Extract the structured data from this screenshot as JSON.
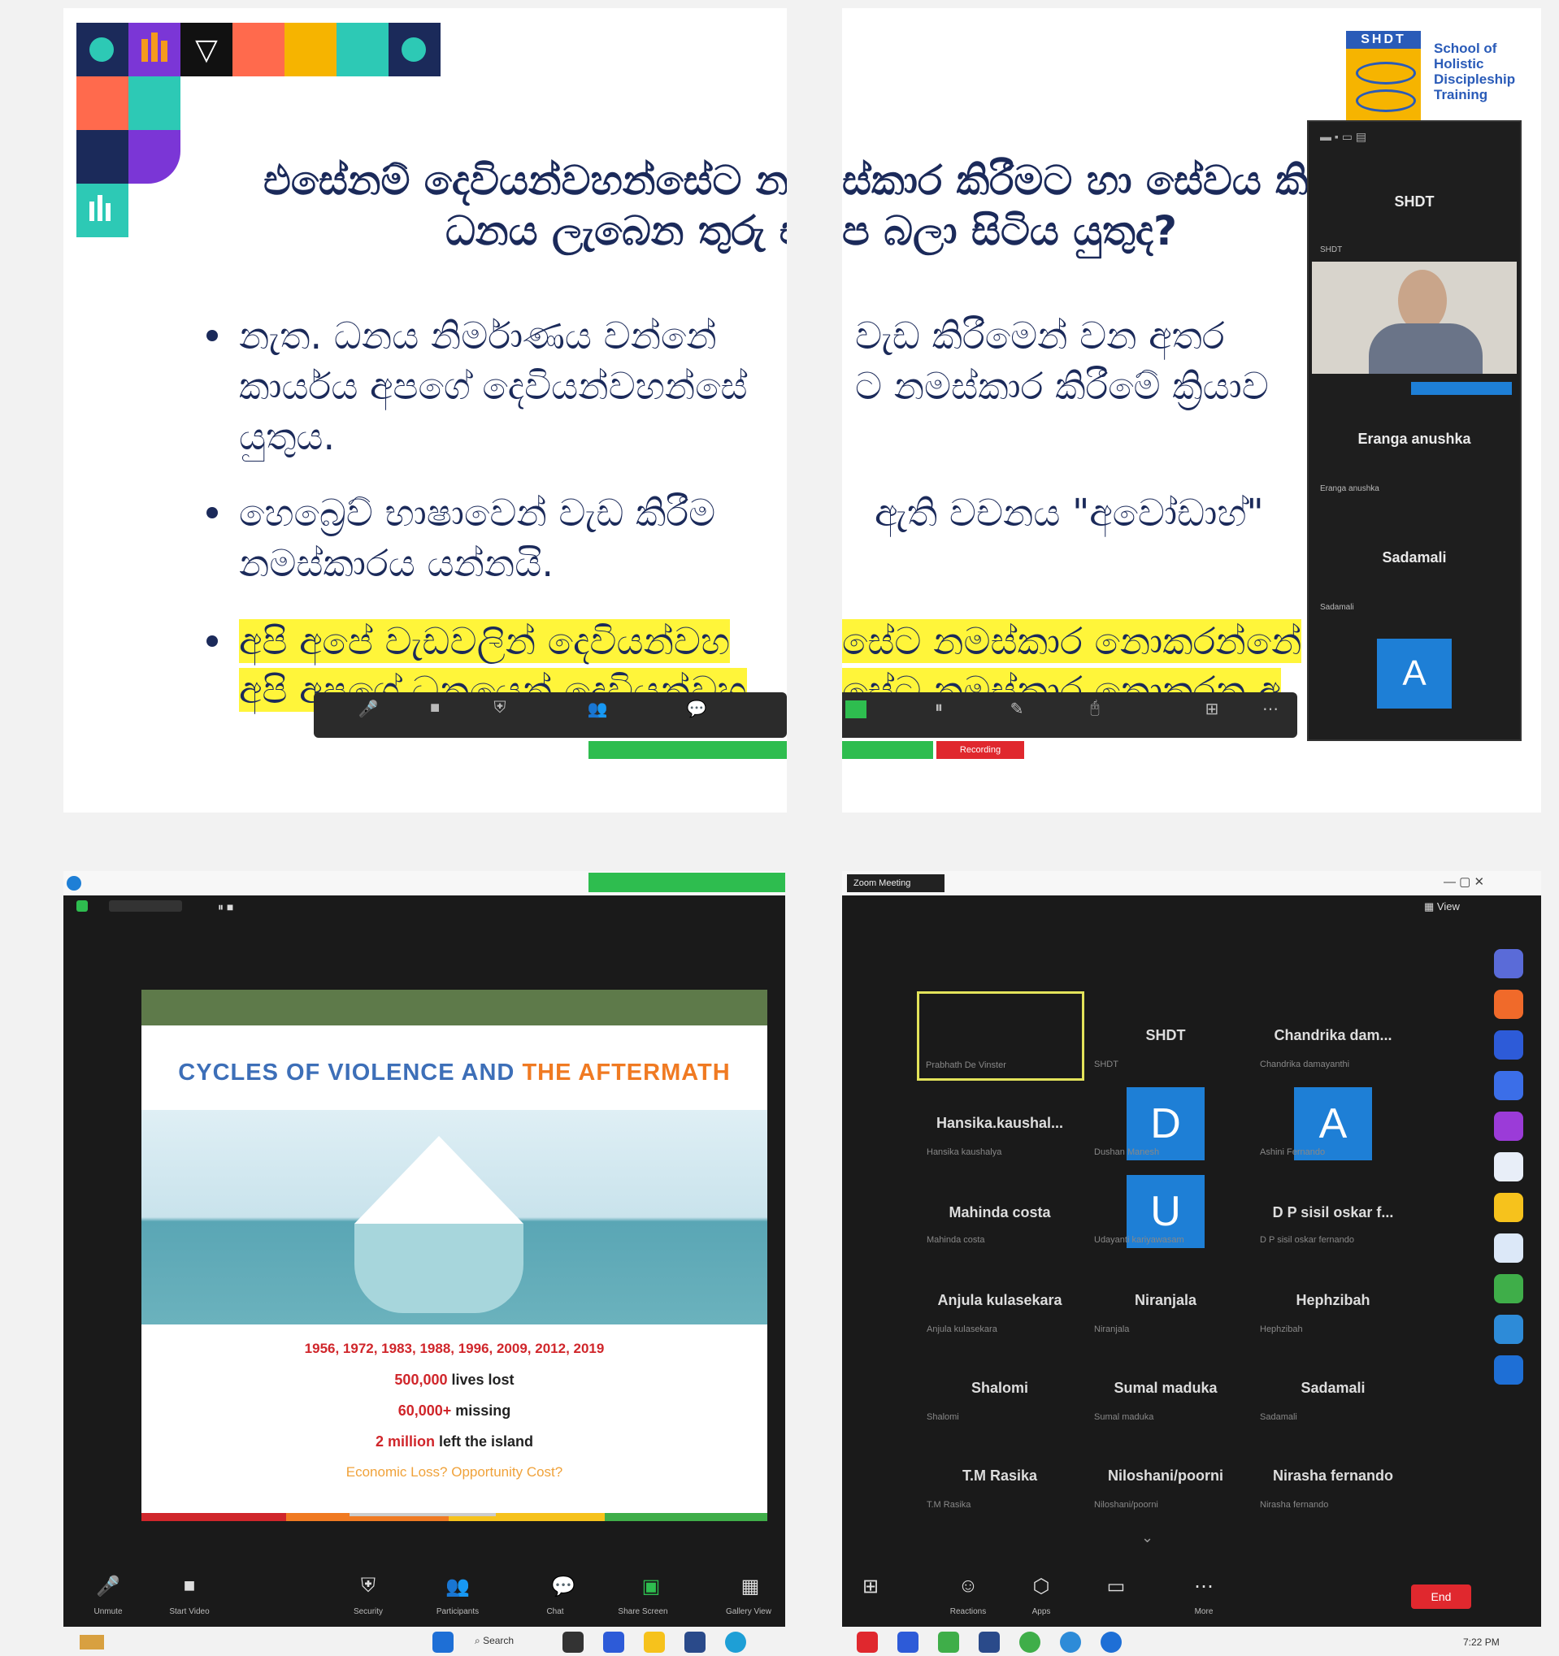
{
  "slide": {
    "title_line1_left": "එසේනම් දෙවියන්වහන්සේට නම",
    "title_line1_right": "ස්කාර කිරීමට හා සේවය කිරී",
    "title_line2_left": "ධනය ලැබෙන තුරු ඒ",
    "title_line2_right": "ප බලා සිටිය යුතුද?",
    "bullet1_l1_left": "නැත. ධනය නිර්මාණය වන්නේ",
    "bullet1_l1_right": "වැඩ කිරීමෙන් වන අතර",
    "bullet1_l2_left": "කාර්යය අපගේ දෙවියන්වහන්සේ",
    "bullet1_l2_right": "ට නමස්කාර කිරීමේ ක්‍රියාව",
    "bullet1_l3": "යුතුය.",
    "bullet2_l1_left": "හෙබ්‍රෙව් භාෂාවෙන් වැඩ කිරීම",
    "bullet2_l1_right": "ඇති වචනය \"අවෝඩාහ්\"",
    "bullet2_l2": "නමස්කාරය යන්නයි.",
    "bullet3_l1_left": "අපි අපේ වැඩවලින් දෙවියන්වහ",
    "bullet3_l1_right": "සේට නමස්කාර නොකරන්නේ",
    "bullet3_l2_left": "අපි අපගේ ධනයෙන් දෙවියන්වහ",
    "bullet3_l2_right": "සේට නමස්කාර නොකරන අ",
    "logo_badge": "SHDT",
    "logo_text": [
      "School of",
      "Holistic",
      "Discipleship",
      "Training"
    ]
  },
  "participant_panel": {
    "tiles": [
      {
        "name": "SHDT",
        "sub": "SHDT"
      },
      {
        "name": "Eranga anushka",
        "sub": "Eranga anushka"
      },
      {
        "name": "Sadamali",
        "sub": "Sadamali"
      }
    ],
    "avatar_letter": "A"
  },
  "recording_badge": "Recording",
  "bottom_left": {
    "slide_title_part1": "CYCLES OF VIOLENCE AND",
    "slide_title_part2": "THE AFTERMATH",
    "years": "1956, 1972, 1983, 1988, 1996, 2009, 2012, 2019",
    "lines": [
      {
        "num": "500,000",
        "rest": "lives lost"
      },
      {
        "num": "60,000+",
        "rest": "missing"
      },
      {
        "num": "2 million",
        "rest": "left the island"
      }
    ],
    "question": "Economic Loss? Opportunity Cost?",
    "toolbar": [
      "Unmute",
      "Start Video",
      "Security",
      "Participants",
      "Chat",
      "Share Screen",
      "Gallery View"
    ]
  },
  "bottom_right": {
    "window_title": "Zoom Meeting",
    "view_label": "View",
    "tiles": [
      {
        "name": "SHDT",
        "sub": "SHDT"
      },
      {
        "name": "Chandrika dam...",
        "sub": "Chandrika damayanthi"
      },
      {
        "name": "Hansika.kaushal...",
        "sub": "Hansika kaushalya"
      },
      {
        "name": "",
        "sub": "Dushan Manesh",
        "avatar": "D"
      },
      {
        "name": "",
        "sub": "Ashini Fernando",
        "avatar": "A"
      },
      {
        "name": "Mahinda costa",
        "sub": "Mahinda costa"
      },
      {
        "name": "",
        "sub": "Udayanti kariyawasam",
        "avatar": "U"
      },
      {
        "name": "D P sisil oskar f...",
        "sub": "D P sisil oskar fernando"
      },
      {
        "name": "Anjula kulasekara",
        "sub": "Anjula kulasekara"
      },
      {
        "name": "Niranjala",
        "sub": "Niranjala"
      },
      {
        "name": "Hephzibah",
        "sub": "Hephzibah"
      },
      {
        "name": "Shalomi",
        "sub": "Shalomi"
      },
      {
        "name": "Sumal maduka",
        "sub": "Sumal maduka"
      },
      {
        "name": "Sadamali",
        "sub": "Sadamali"
      },
      {
        "name": "T.M Rasika",
        "sub": "T.M Rasika"
      },
      {
        "name": "Niloshani/poorni",
        "sub": "Niloshani/poorni"
      },
      {
        "name": "Nirasha fernando",
        "sub": "Nirasha fernando"
      }
    ],
    "first_tile_sub": "Prabhath De Vinster",
    "toolbar": [
      "Apps",
      "Reactions",
      "More"
    ],
    "end_label": "End"
  },
  "taskbar": {
    "search_label": "Search",
    "time": "7:22 PM"
  }
}
